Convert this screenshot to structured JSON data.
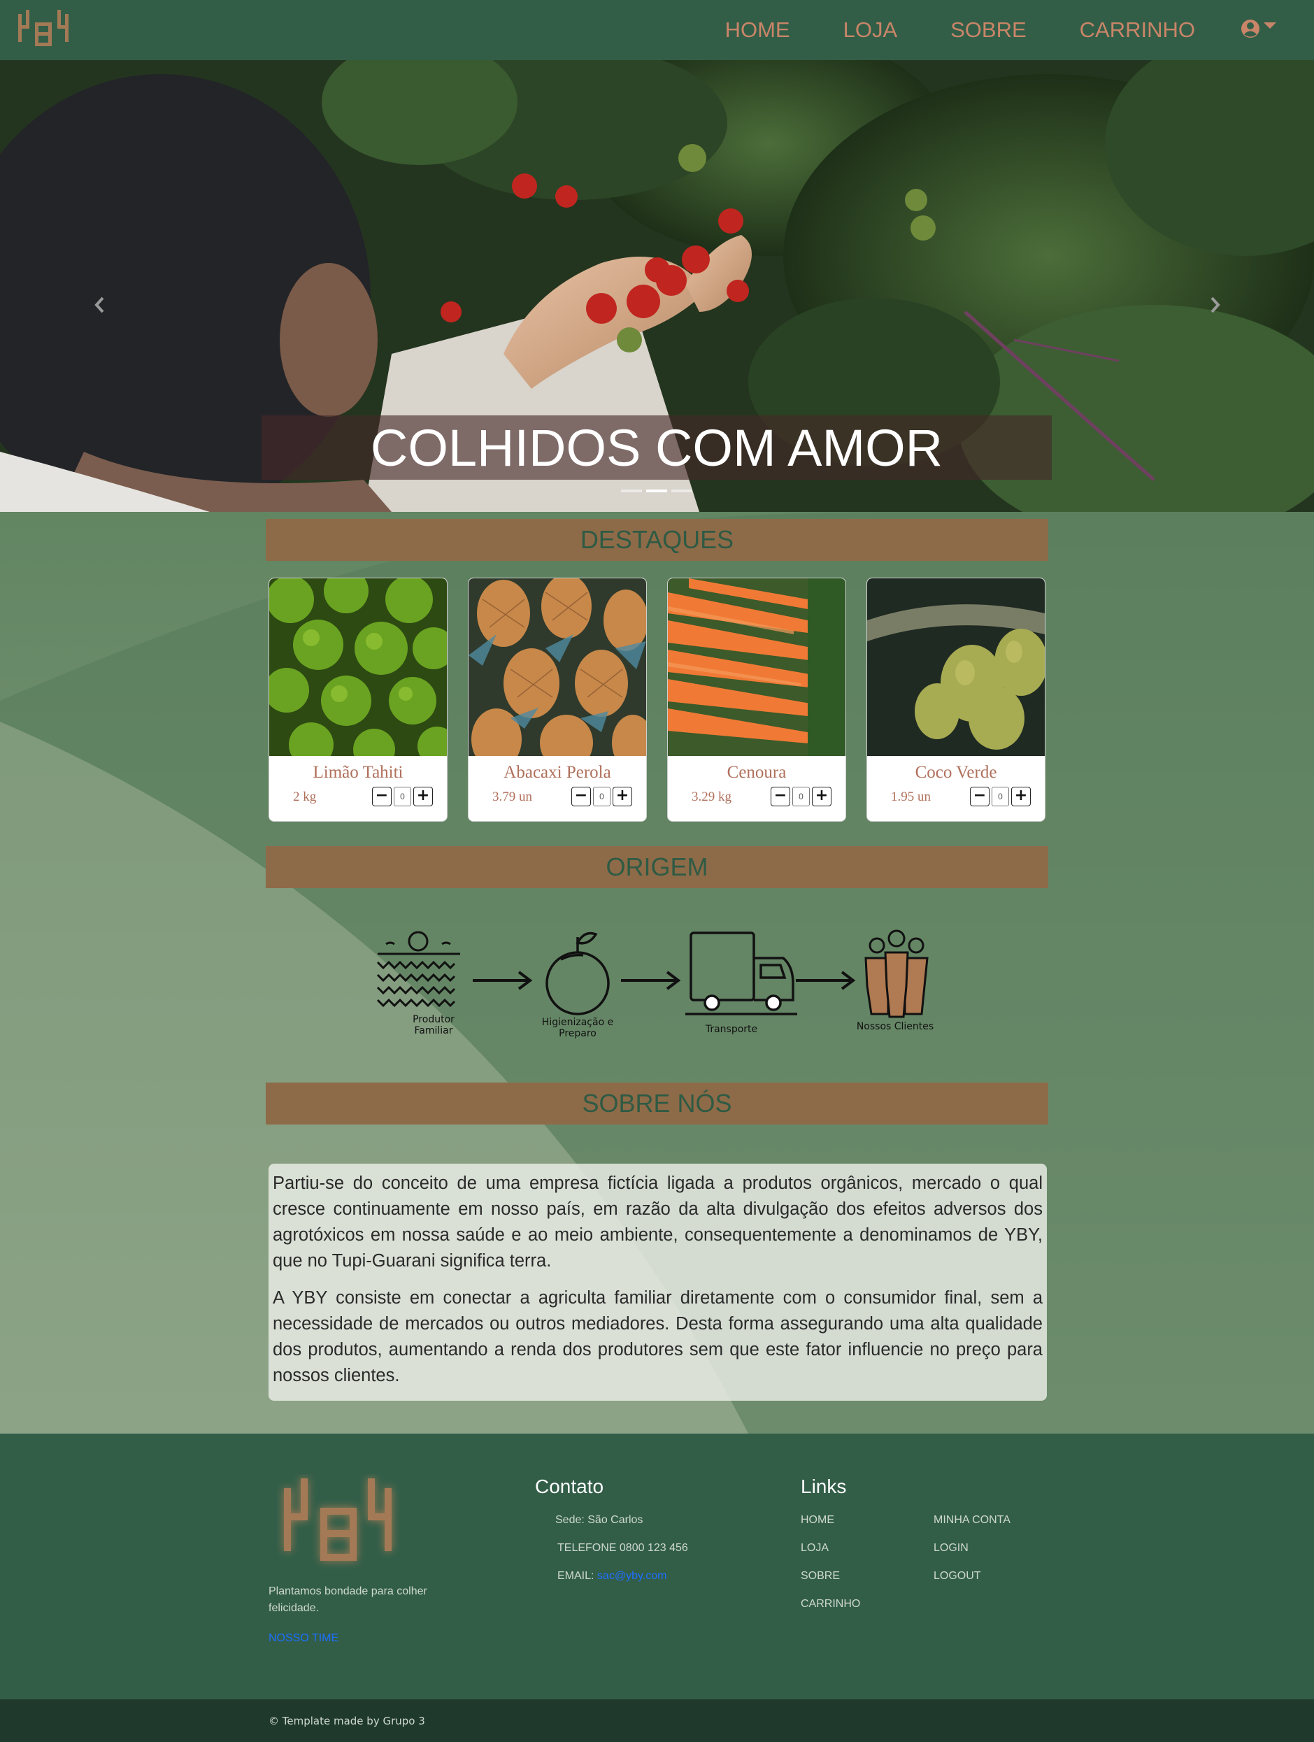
{
  "nav": {
    "logo_text": "YBY",
    "items": [
      {
        "label": "HOME"
      },
      {
        "label": "LOJA"
      },
      {
        "label": "SOBRE"
      },
      {
        "label": "CARRINHO"
      }
    ],
    "user_icon": "user-circle-icon"
  },
  "hero": {
    "caption": "COLHIDOS COM AMOR",
    "slides": 3,
    "active_slide": 2,
    "prev_icon": "chevron-left-icon",
    "next_icon": "chevron-right-icon"
  },
  "sections": {
    "destaques": "DESTAQUES",
    "origem": "ORIGEM",
    "sobre": "SOBRE NÓS"
  },
  "products": [
    {
      "name": "Limão Tahiti",
      "price": "2 kg",
      "qty": "0"
    },
    {
      "name": "Abacaxi Perola",
      "price": "3.79 un",
      "qty": "0"
    },
    {
      "name": "Cenoura",
      "price": "3.29 kg",
      "qty": "0"
    },
    {
      "name": "Coco Verde",
      "price": "1.95 un",
      "qty": "0"
    }
  ],
  "origin_steps": [
    {
      "label_line1": "Produtor",
      "label_line2": "Familiar",
      "icon": "farm-field-icon"
    },
    {
      "label_line1": "Higienização e",
      "label_line2": "Preparo",
      "icon": "fruit-icon"
    },
    {
      "label_line1": "Transporte",
      "label_line2": "",
      "icon": "truck-icon"
    },
    {
      "label_line1": "Nossos Clientes",
      "label_line2": "",
      "icon": "people-icon"
    }
  ],
  "about": {
    "p1": "Partiu-se do conceito de uma empresa fictícia ligada a produtos orgânicos, mercado o qual cresce continuamente em nosso país, em razão da alta divulgação dos efeitos adversos dos agrotóxicos em nossa saúde e ao meio ambiente, consequentemente a denominamos de YBY, que no Tupi-Guarani significa terra.",
    "p2": "A YBY consiste em conectar a agriculta familiar diretamente com o consumidor final, sem a necessidade de mercados ou outros mediadores. Desta forma assegurando uma alta qualidade dos produtos, aumentando a renda dos produtores sem que este fator influencie no preço para nossos clientes."
  },
  "footer": {
    "tagline": "Plantamos bondade para colher felicidade.",
    "team_link": "NOSSO TIME",
    "contato_title": "Contato",
    "sede": "Sede: São Carlos",
    "telefone": "TELEFONE 0800 123 456",
    "email_label": "EMAIL:",
    "email": "sac@yby.com",
    "links_title": "Links",
    "links_col1": [
      "HOME",
      "LOJA",
      "SOBRE",
      "CARRINHO"
    ],
    "links_col2": [
      "MINHA CONTA",
      "LOGIN",
      "LOGOUT"
    ]
  },
  "copyright": "© Template made by Grupo 3",
  "colors": {
    "navbar": "#325e48",
    "accent": "#c98568",
    "section_bar": "#8e6b48",
    "footer": "#325e48"
  }
}
